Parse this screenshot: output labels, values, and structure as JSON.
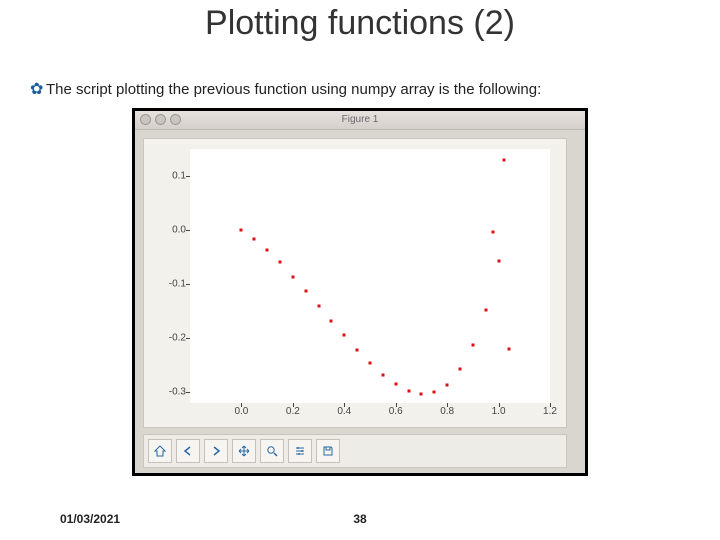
{
  "title": "Plotting functions (2)",
  "bullet": "The script plotting the previous function using numpy array is the following:",
  "footer": {
    "date": "01/03/2021",
    "page": "38"
  },
  "window_title": "Figure 1",
  "toolbar_icons": [
    "home",
    "back",
    "forward",
    "move",
    "zoom",
    "config",
    "save"
  ],
  "chart_data": {
    "type": "scatter",
    "title": "",
    "xlabel": "",
    "ylabel": "",
    "xlim": [
      -0.2,
      1.2
    ],
    "ylim": [
      -0.32,
      0.15
    ],
    "xticks": [
      0.0,
      0.2,
      0.4,
      0.6,
      0.8,
      1.0,
      1.2
    ],
    "yticks": [
      -0.3,
      -0.2,
      -0.1,
      0.0,
      0.1
    ],
    "x": [
      0.0,
      0.05,
      0.1,
      0.15,
      0.2,
      0.25,
      0.3,
      0.35,
      0.4,
      0.45,
      0.5,
      0.55,
      0.6,
      0.65,
      0.7,
      0.75,
      0.8,
      0.85,
      0.9,
      0.95,
      1.0
    ],
    "y": [
      0.0,
      -0.017,
      -0.037,
      -0.06,
      -0.086,
      -0.113,
      -0.14,
      -0.168,
      -0.195,
      -0.222,
      -0.246,
      -0.268,
      -0.285,
      -0.298,
      -0.303,
      -0.3,
      -0.286,
      -0.258,
      -0.213,
      -0.148,
      -0.058
    ],
    "extra_points": [
      {
        "x": 1.02,
        "y": 0.13
      },
      {
        "x": 0.98,
        "y": -0.004
      },
      {
        "x": 1.04,
        "y": -0.22
      }
    ],
    "marker": "point",
    "color": "#dd1111"
  }
}
